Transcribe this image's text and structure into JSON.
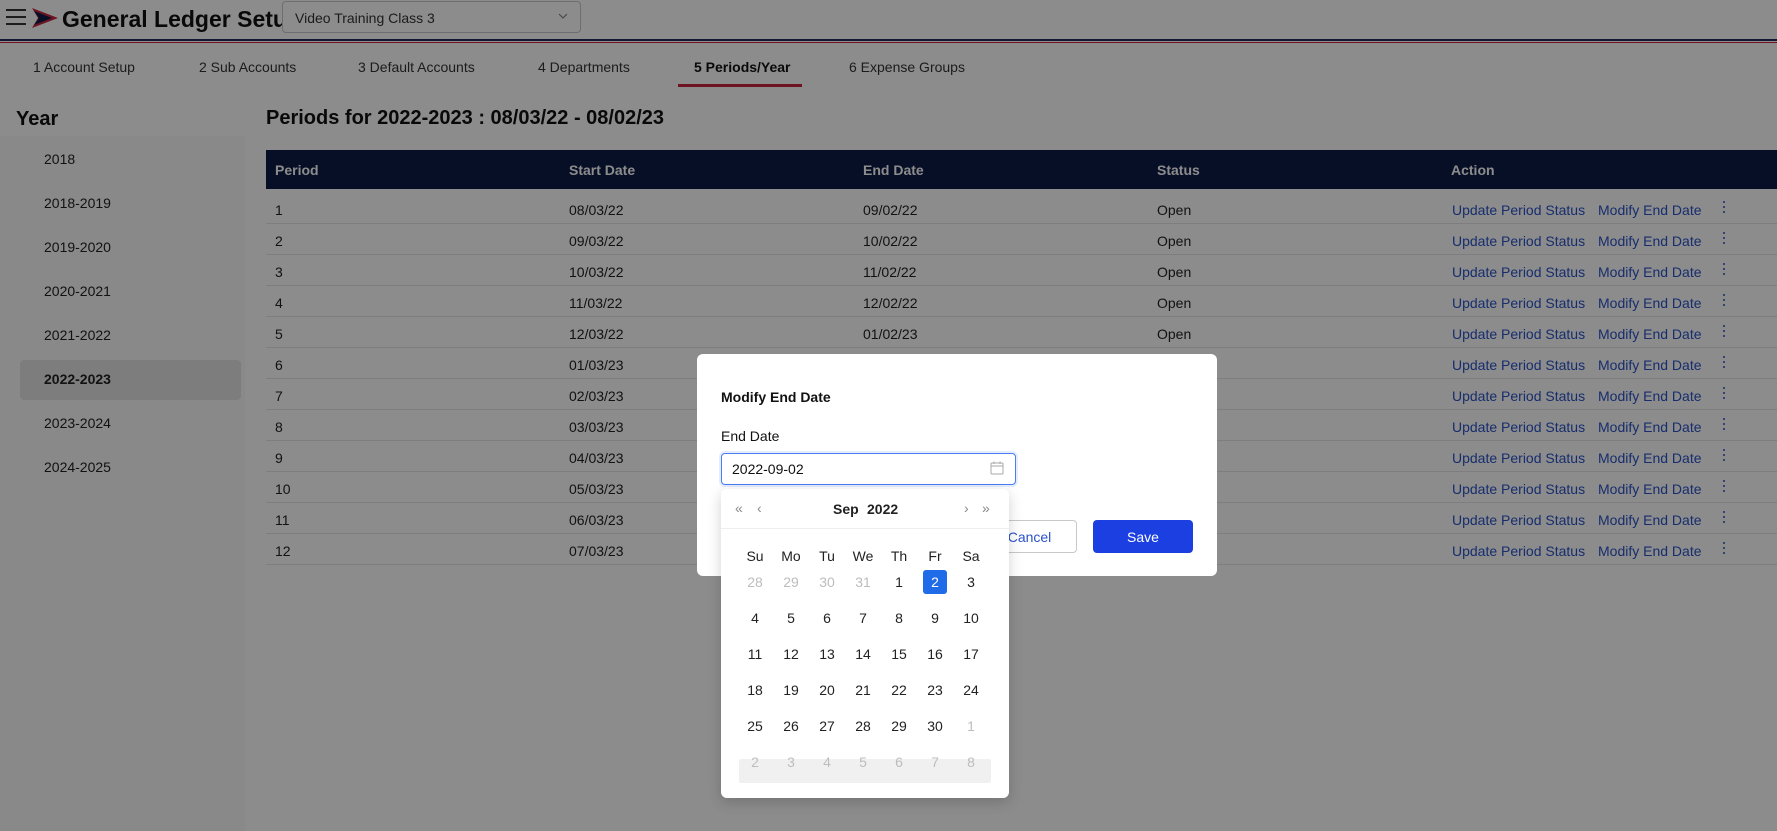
{
  "app": {
    "title": "General Ledger Setup",
    "company_select": "Video Training Class 3"
  },
  "tabs": [
    {
      "label": "1 Account Setup"
    },
    {
      "label": "2 Sub Accounts"
    },
    {
      "label": "3 Default Accounts"
    },
    {
      "label": "4 Departments"
    },
    {
      "label": "5 Periods/Year",
      "active": true
    },
    {
      "label": "6 Expense Groups"
    }
  ],
  "sidebar": {
    "heading": "Year",
    "years": [
      "2018",
      "2018-2019",
      "2019-2020",
      "2020-2021",
      "2021-2022",
      "2022-2023",
      "2023-2024",
      "2024-2025"
    ],
    "selected": "2022-2023"
  },
  "main": {
    "title": "Periods for 2022-2023 : 08/03/22 - 08/02/23",
    "columns": [
      "Period",
      "Start Date",
      "End Date",
      "Status",
      "Action"
    ],
    "actions": {
      "update": "Update Period Status",
      "modify": "Modify End Date"
    },
    "rows": [
      [
        "1",
        "08/03/22",
        "09/02/22",
        "Open"
      ],
      [
        "2",
        "09/03/22",
        "10/02/22",
        "Open"
      ],
      [
        "3",
        "10/03/22",
        "11/02/22",
        "Open"
      ],
      [
        "4",
        "11/03/22",
        "12/02/22",
        "Open"
      ],
      [
        "5",
        "12/03/22",
        "01/02/23",
        "Open"
      ],
      [
        "6",
        "01/03/23",
        "",
        ""
      ],
      [
        "7",
        "02/03/23",
        "",
        ""
      ],
      [
        "8",
        "03/03/23",
        "",
        ""
      ],
      [
        "9",
        "04/03/23",
        "",
        ""
      ],
      [
        "10",
        "05/03/23",
        "",
        ""
      ],
      [
        "11",
        "06/03/23",
        "",
        ""
      ],
      [
        "12",
        "07/03/23",
        "",
        ""
      ]
    ]
  },
  "modal": {
    "title": "Modify End Date",
    "field_label": "End Date",
    "value": "2022-09-02",
    "cancel": "Cancel",
    "save": "Save"
  },
  "calendar": {
    "month": "Sep",
    "year": "2022",
    "prev_year": "«",
    "prev_month": "‹",
    "next_month": "›",
    "next_year": "»",
    "weekdays": [
      "Su",
      "Mo",
      "Tu",
      "We",
      "Th",
      "Fr",
      "Sa"
    ],
    "weeks": [
      [
        "28",
        "29",
        "30",
        "31",
        "1",
        "2",
        "3"
      ],
      [
        "4",
        "5",
        "6",
        "7",
        "8",
        "9",
        "10"
      ],
      [
        "11",
        "12",
        "13",
        "14",
        "15",
        "16",
        "17"
      ],
      [
        "18",
        "19",
        "20",
        "21",
        "22",
        "23",
        "24"
      ],
      [
        "25",
        "26",
        "27",
        "28",
        "29",
        "30",
        "1"
      ],
      [
        "2",
        "3",
        "4",
        "5",
        "6",
        "7",
        "8"
      ]
    ],
    "selected": "2",
    "colors": {
      "selected": "#1f6be8",
      "accent_navy": "#0e1d48",
      "accent_red": "#c8243c",
      "link": "#2a53c7",
      "primary_button": "#1b3fe0"
    }
  }
}
